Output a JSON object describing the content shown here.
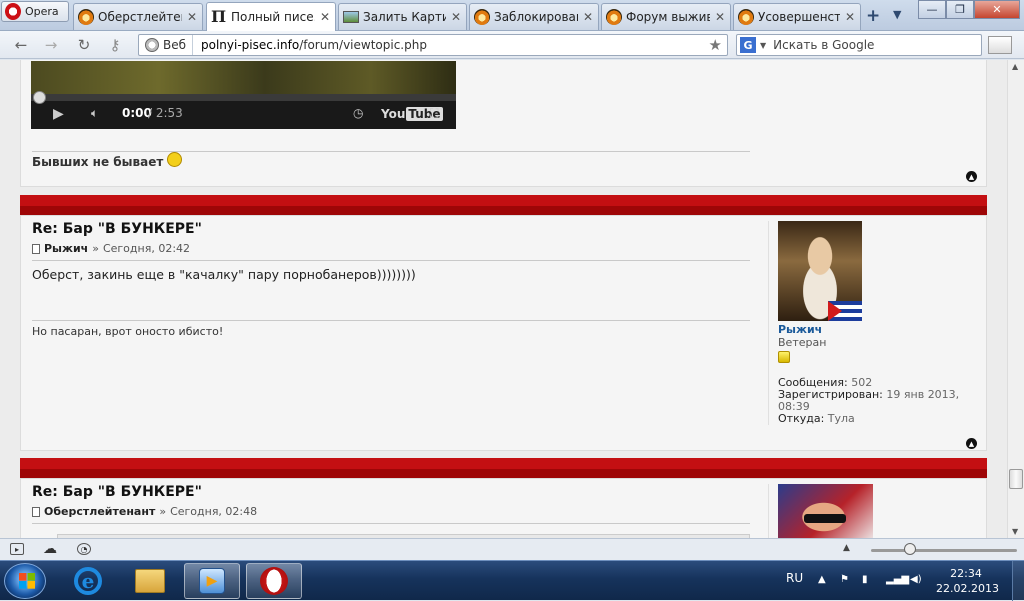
{
  "browser": {
    "menu_label": "Opera",
    "tabs": [
      {
        "title": "Оберстлейтен...",
        "icon": "bunker-favicon-icon"
      },
      {
        "title": "Полный писе...",
        "icon": "p-favicon-icon"
      },
      {
        "title": "Залить Картин...",
        "icon": "image-favicon-icon"
      },
      {
        "title": "Заблокирован...",
        "icon": "bunker-favicon-icon"
      },
      {
        "title": "Форум выжив...",
        "icon": "bunker-favicon-icon"
      },
      {
        "title": "Усовершенств...",
        "icon": "bunker-favicon-icon"
      }
    ],
    "active_tab_index": 1,
    "address": {
      "chip": "Веб",
      "url_domain": "polnyi-pisec.info",
      "url_path": "/forum/viewtopic.php"
    },
    "search": {
      "placeholder": "Искать в Google",
      "engine": "G"
    }
  },
  "video": {
    "time_current": "0:00",
    "time_total": "/ 2:53",
    "brand": "You",
    "brand_box": "Tube"
  },
  "post0": {
    "signature": "Бывших не бывает"
  },
  "post1": {
    "title": "Re: Бар \"В БУНКЕРЕ\"",
    "author": "Рыжич",
    "meta_sep": "»",
    "time": "Сегодня, 02:42",
    "message": "Оберст, закинь еще в \"качалку\" пару порнобанеров))))))))",
    "signature": "Но пасаран, врот оносто ибисто!",
    "profile": {
      "name": "Рыжич",
      "rank": "Ветеран",
      "posts_label": "Сообщения:",
      "posts": "502",
      "registered_label": "Зарегистрирован:",
      "registered": "19 янв 2013,",
      "registered_time": "08:39",
      "from_label": "Откуда:",
      "from": "Тула"
    }
  },
  "post2": {
    "title": "Re: Бар \"В БУНКЕРЕ\"",
    "author": "Оберстлейтенант",
    "meta_sep": "»",
    "time": "Сегодня, 02:48"
  },
  "taskbar": {
    "lang": "RU",
    "time": "22:34",
    "date": "22.02.2013"
  },
  "colors": {
    "post_bar": "#b30b0e",
    "profile_name": "#1b5a9a"
  }
}
